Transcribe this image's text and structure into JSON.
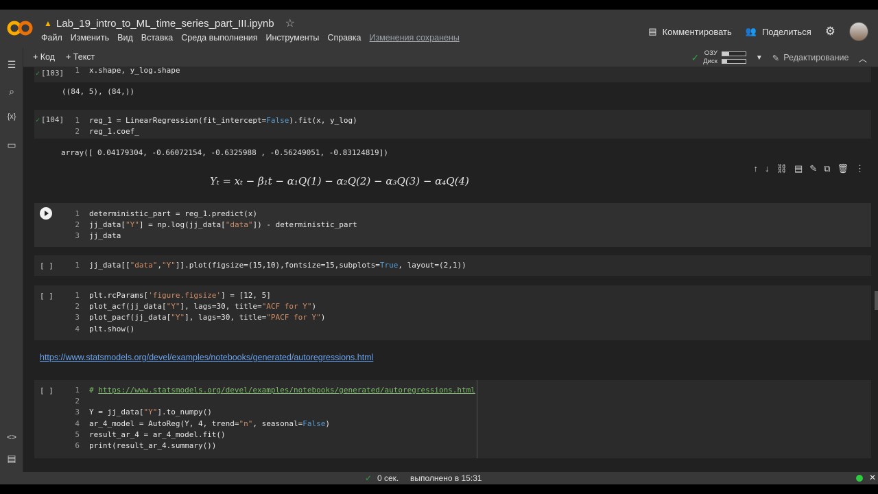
{
  "app": {
    "logo_text": "CO",
    "notebook_title": "Lab_19_intro_to_ML_time_series_part_III.ipynb",
    "menu": [
      "Файл",
      "Изменить",
      "Вид",
      "Вставка",
      "Среда выполнения",
      "Инструменты",
      "Справка"
    ],
    "saved_status": "Изменения сохранены",
    "comment_label": "Комментировать",
    "share_label": "Поделиться"
  },
  "toolbar": {
    "add_code": "+ Код",
    "add_text": "+ Текст",
    "ram_label": "ОЗУ",
    "disk_label": "Диск",
    "ram_level": 0.3,
    "disk_level": 0.2,
    "edit_mode": "Редактирование"
  },
  "cells": {
    "c103": {
      "exec": "[103]",
      "line1_num": "1",
      "line1": "x.shape, y_log.shape",
      "output": "((84, 5), (84,))"
    },
    "c104": {
      "exec": "[104]",
      "lines": [
        {
          "n": "1",
          "pre": "reg_1 = LinearRegression(fit_intercept=",
          "kw": "False",
          "post": ").fit(x, y_log)"
        },
        {
          "n": "2",
          "text": "reg_1.coef_"
        }
      ],
      "output": "array([ 0.04179304, -0.66072154, -0.6325988 , -0.56249051, -0.83124819])"
    },
    "formula": "Yₜ = xₜ − β₁t − α₁Q(1) − α₂Q(2) − α₃Q(3) − α₄Q(4)",
    "c_det": {
      "l1n": "1",
      "l1": "deterministic_part = reg_1.predict(x)",
      "l2n": "2",
      "l2a": "jj_data[",
      "l2s1": "\"Y\"",
      "l2b": "] = np.log(jj_data[",
      "l2s2": "\"data\"",
      "l2c": "]) - deterministic_part",
      "l3n": "3",
      "l3": "jj_data"
    },
    "c_plot": {
      "exec": "[ ]",
      "n": "1",
      "a": "jj_data[[",
      "s1": "\"data\"",
      "b": ",",
      "s2": "\"Y\"",
      "c": "]].plot(figsize=(15,10),fontsize=15,subplots=",
      "kw": "True",
      "d": ", layout=(2,1))"
    },
    "c_acf": {
      "exec": "[ ]",
      "l1n": "1",
      "l1a": "plt.rcParams[",
      "l1s": "'figure.figsize'",
      "l1b": "] = [12, 5]",
      "l2n": "2",
      "l2a": "plot_acf(jj_data[",
      "l2s": "\"Y\"",
      "l2b": "], lags=30, title=",
      "l2s2": "\"ACF for Y\"",
      "l2c": ")",
      "l3n": "3",
      "l3a": "plot_pacf(jj_data[",
      "l3s": "\"Y\"",
      "l3b": "], lags=30, title=",
      "l3s2": "\"PACF for Y\"",
      "l3c": ")",
      "l4n": "4",
      "l4": "plt.show()"
    },
    "link": "https://www.statsmodels.org/devel/examples/notebooks/generated/autoregressions.html",
    "c_ar": {
      "exec": "[ ]",
      "l1n": "1",
      "l1hash": "# ",
      "l1url": "https://www.statsmodels.org/devel/examples/notebooks/generated/autoregressions.html",
      "l2n": "2",
      "l3n": "3",
      "l3a": "Y = jj_data[",
      "l3s": "\"Y\"",
      "l3b": "].to_numpy()",
      "l4n": "4",
      "l4a": "ar_4_model = AutoReg(Y, 4, trend=",
      "l4s": "\"n\"",
      "l4b": ", seasonal=",
      "l4kw": "False",
      "l4c": ")",
      "l5n": "5",
      "l5": "result_ar_4 = ar_4_model.fit()",
      "l6n": "6",
      "l6": "print(result_ar_4.summary())"
    }
  },
  "status": {
    "time": "0 сек.",
    "completed": "выполнено в 15:31"
  },
  "colors": {
    "accent_green": "#2e9e49",
    "link_blue": "#69a3ee",
    "string": "#cf8f6a",
    "keyword": "#569cd6"
  }
}
